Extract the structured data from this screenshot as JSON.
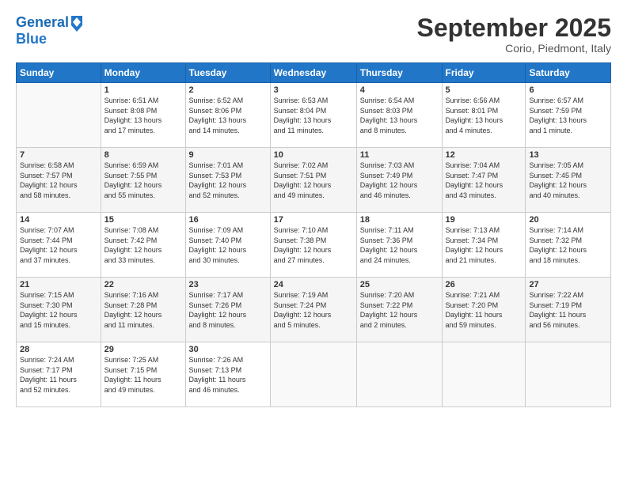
{
  "header": {
    "logo_line1": "General",
    "logo_line2": "Blue",
    "month": "September 2025",
    "location": "Corio, Piedmont, Italy"
  },
  "weekdays": [
    "Sunday",
    "Monday",
    "Tuesday",
    "Wednesday",
    "Thursday",
    "Friday",
    "Saturday"
  ],
  "weeks": [
    [
      {
        "day": "",
        "info": ""
      },
      {
        "day": "1",
        "info": "Sunrise: 6:51 AM\nSunset: 8:08 PM\nDaylight: 13 hours\nand 17 minutes."
      },
      {
        "day": "2",
        "info": "Sunrise: 6:52 AM\nSunset: 8:06 PM\nDaylight: 13 hours\nand 14 minutes."
      },
      {
        "day": "3",
        "info": "Sunrise: 6:53 AM\nSunset: 8:04 PM\nDaylight: 13 hours\nand 11 minutes."
      },
      {
        "day": "4",
        "info": "Sunrise: 6:54 AM\nSunset: 8:03 PM\nDaylight: 13 hours\nand 8 minutes."
      },
      {
        "day": "5",
        "info": "Sunrise: 6:56 AM\nSunset: 8:01 PM\nDaylight: 13 hours\nand 4 minutes."
      },
      {
        "day": "6",
        "info": "Sunrise: 6:57 AM\nSunset: 7:59 PM\nDaylight: 13 hours\nand 1 minute."
      }
    ],
    [
      {
        "day": "7",
        "info": "Sunrise: 6:58 AM\nSunset: 7:57 PM\nDaylight: 12 hours\nand 58 minutes."
      },
      {
        "day": "8",
        "info": "Sunrise: 6:59 AM\nSunset: 7:55 PM\nDaylight: 12 hours\nand 55 minutes."
      },
      {
        "day": "9",
        "info": "Sunrise: 7:01 AM\nSunset: 7:53 PM\nDaylight: 12 hours\nand 52 minutes."
      },
      {
        "day": "10",
        "info": "Sunrise: 7:02 AM\nSunset: 7:51 PM\nDaylight: 12 hours\nand 49 minutes."
      },
      {
        "day": "11",
        "info": "Sunrise: 7:03 AM\nSunset: 7:49 PM\nDaylight: 12 hours\nand 46 minutes."
      },
      {
        "day": "12",
        "info": "Sunrise: 7:04 AM\nSunset: 7:47 PM\nDaylight: 12 hours\nand 43 minutes."
      },
      {
        "day": "13",
        "info": "Sunrise: 7:05 AM\nSunset: 7:45 PM\nDaylight: 12 hours\nand 40 minutes."
      }
    ],
    [
      {
        "day": "14",
        "info": "Sunrise: 7:07 AM\nSunset: 7:44 PM\nDaylight: 12 hours\nand 37 minutes."
      },
      {
        "day": "15",
        "info": "Sunrise: 7:08 AM\nSunset: 7:42 PM\nDaylight: 12 hours\nand 33 minutes."
      },
      {
        "day": "16",
        "info": "Sunrise: 7:09 AM\nSunset: 7:40 PM\nDaylight: 12 hours\nand 30 minutes."
      },
      {
        "day": "17",
        "info": "Sunrise: 7:10 AM\nSunset: 7:38 PM\nDaylight: 12 hours\nand 27 minutes."
      },
      {
        "day": "18",
        "info": "Sunrise: 7:11 AM\nSunset: 7:36 PM\nDaylight: 12 hours\nand 24 minutes."
      },
      {
        "day": "19",
        "info": "Sunrise: 7:13 AM\nSunset: 7:34 PM\nDaylight: 12 hours\nand 21 minutes."
      },
      {
        "day": "20",
        "info": "Sunrise: 7:14 AM\nSunset: 7:32 PM\nDaylight: 12 hours\nand 18 minutes."
      }
    ],
    [
      {
        "day": "21",
        "info": "Sunrise: 7:15 AM\nSunset: 7:30 PM\nDaylight: 12 hours\nand 15 minutes."
      },
      {
        "day": "22",
        "info": "Sunrise: 7:16 AM\nSunset: 7:28 PM\nDaylight: 12 hours\nand 11 minutes."
      },
      {
        "day": "23",
        "info": "Sunrise: 7:17 AM\nSunset: 7:26 PM\nDaylight: 12 hours\nand 8 minutes."
      },
      {
        "day": "24",
        "info": "Sunrise: 7:19 AM\nSunset: 7:24 PM\nDaylight: 12 hours\nand 5 minutes."
      },
      {
        "day": "25",
        "info": "Sunrise: 7:20 AM\nSunset: 7:22 PM\nDaylight: 12 hours\nand 2 minutes."
      },
      {
        "day": "26",
        "info": "Sunrise: 7:21 AM\nSunset: 7:20 PM\nDaylight: 11 hours\nand 59 minutes."
      },
      {
        "day": "27",
        "info": "Sunrise: 7:22 AM\nSunset: 7:19 PM\nDaylight: 11 hours\nand 56 minutes."
      }
    ],
    [
      {
        "day": "28",
        "info": "Sunrise: 7:24 AM\nSunset: 7:17 PM\nDaylight: 11 hours\nand 52 minutes."
      },
      {
        "day": "29",
        "info": "Sunrise: 7:25 AM\nSunset: 7:15 PM\nDaylight: 11 hours\nand 49 minutes."
      },
      {
        "day": "30",
        "info": "Sunrise: 7:26 AM\nSunset: 7:13 PM\nDaylight: 11 hours\nand 46 minutes."
      },
      {
        "day": "",
        "info": ""
      },
      {
        "day": "",
        "info": ""
      },
      {
        "day": "",
        "info": ""
      },
      {
        "day": "",
        "info": ""
      }
    ]
  ]
}
